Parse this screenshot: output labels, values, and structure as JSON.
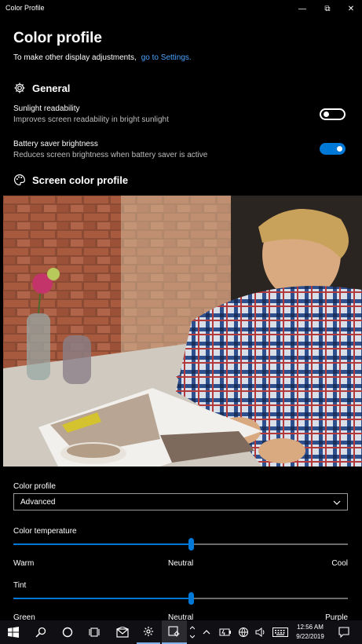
{
  "window": {
    "title": "Color Profile",
    "minimize_glyph": "—",
    "maximize_glyph": "⧉",
    "close_glyph": "✕"
  },
  "page": {
    "title": "Color profile",
    "adjust_text": "To make other display adjustments,",
    "settings_link": "go to Settings."
  },
  "general": {
    "heading": "General",
    "icon": "gear-icon",
    "sunlight": {
      "title": "Sunlight readability",
      "desc": "Improves screen readability in bright sunlight",
      "enabled": false
    },
    "battery": {
      "title": "Battery saver brightness",
      "desc": "Reduces screen brightness when battery saver is active",
      "enabled": true
    }
  },
  "screen_profile": {
    "heading": "Screen color profile",
    "icon": "palette-icon",
    "photo": "man-reading-magazine-photo"
  },
  "color_profile": {
    "label": "Color profile",
    "selected": "Advanced"
  },
  "color_temperature": {
    "label": "Color temperature",
    "value_fraction": 0.53,
    "left": "Warm",
    "center": "Neutral",
    "right": "Cool"
  },
  "tint": {
    "label": "Tint",
    "value_fraction": 0.53,
    "left": "Green",
    "center": "Neutral",
    "right": "Purple"
  },
  "taskbar": {
    "time": "12:56 AM",
    "date": "9/22/2019",
    "icons": [
      "windows-start-icon",
      "search-icon",
      "cortana-icon",
      "task-view-icon",
      "mail-icon",
      "settings-icon",
      "color-profile-app-icon",
      "chevron-up-icon",
      "battery-icon",
      "network-icon",
      "volume-icon",
      "keyboard-icon",
      "action-center-icon"
    ]
  },
  "colors": {
    "accent": "#0078d7",
    "link": "#4aa3ff",
    "background": "#000000"
  }
}
